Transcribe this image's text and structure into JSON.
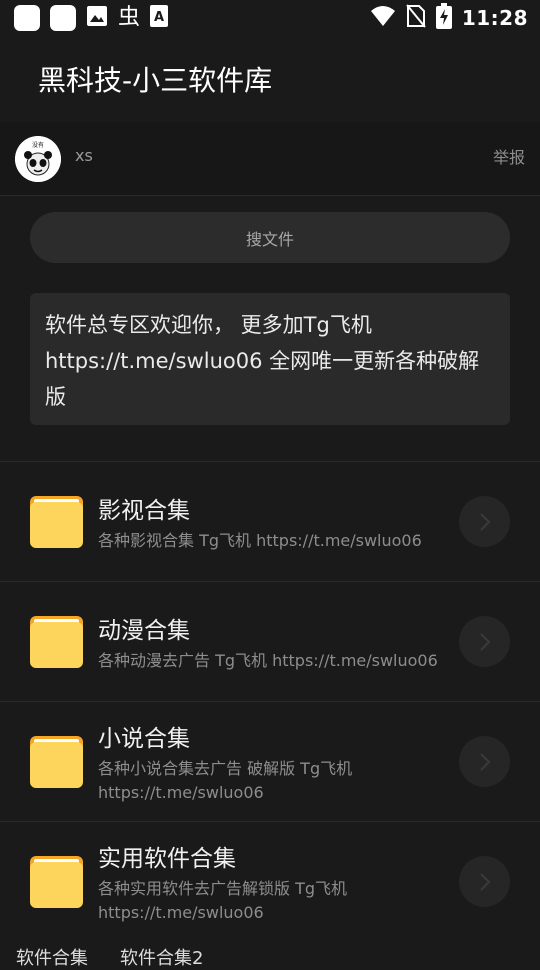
{
  "status_bar": {
    "time": "11:28",
    "icons": [
      "app-square-icon",
      "app-square-icon",
      "image-icon",
      "bug-icon",
      "text-a-icon",
      "wifi-icon",
      "no-sim-icon",
      "battery-charging-icon"
    ]
  },
  "app_bar": {
    "title": "黑科技-小三软件库"
  },
  "user": {
    "name": "xs",
    "report_label": "举报",
    "avatar_caption": "没有"
  },
  "search": {
    "placeholder": "搜文件"
  },
  "notice": {
    "text": "软件总专区欢迎你， 更多加Tg飞机 https://t.me/swluo06 全网唯一更新各种破解版"
  },
  "items": [
    {
      "title": "影视合集",
      "desc": "各种影视合集 Tg飞机 https://t.me/swluo06"
    },
    {
      "title": "动漫合集",
      "desc": "各种动漫去广告 Tg飞机 https://t.me/swluo06"
    },
    {
      "title": "小说合集",
      "desc": "各种小说合集去广告 破解版 Tg飞机 https://t.me/swluo06"
    },
    {
      "title": "实用软件合集",
      "desc": "各种实用软件去广告解锁版 Tg飞机 https://t.me/swluo06"
    }
  ],
  "bottom_tabs": [
    "软件合集",
    "软件合集2"
  ],
  "colors": {
    "background": "#1a1a1a",
    "folder_yellow": "#fdd45c",
    "folder_tab": "#f6a623"
  }
}
